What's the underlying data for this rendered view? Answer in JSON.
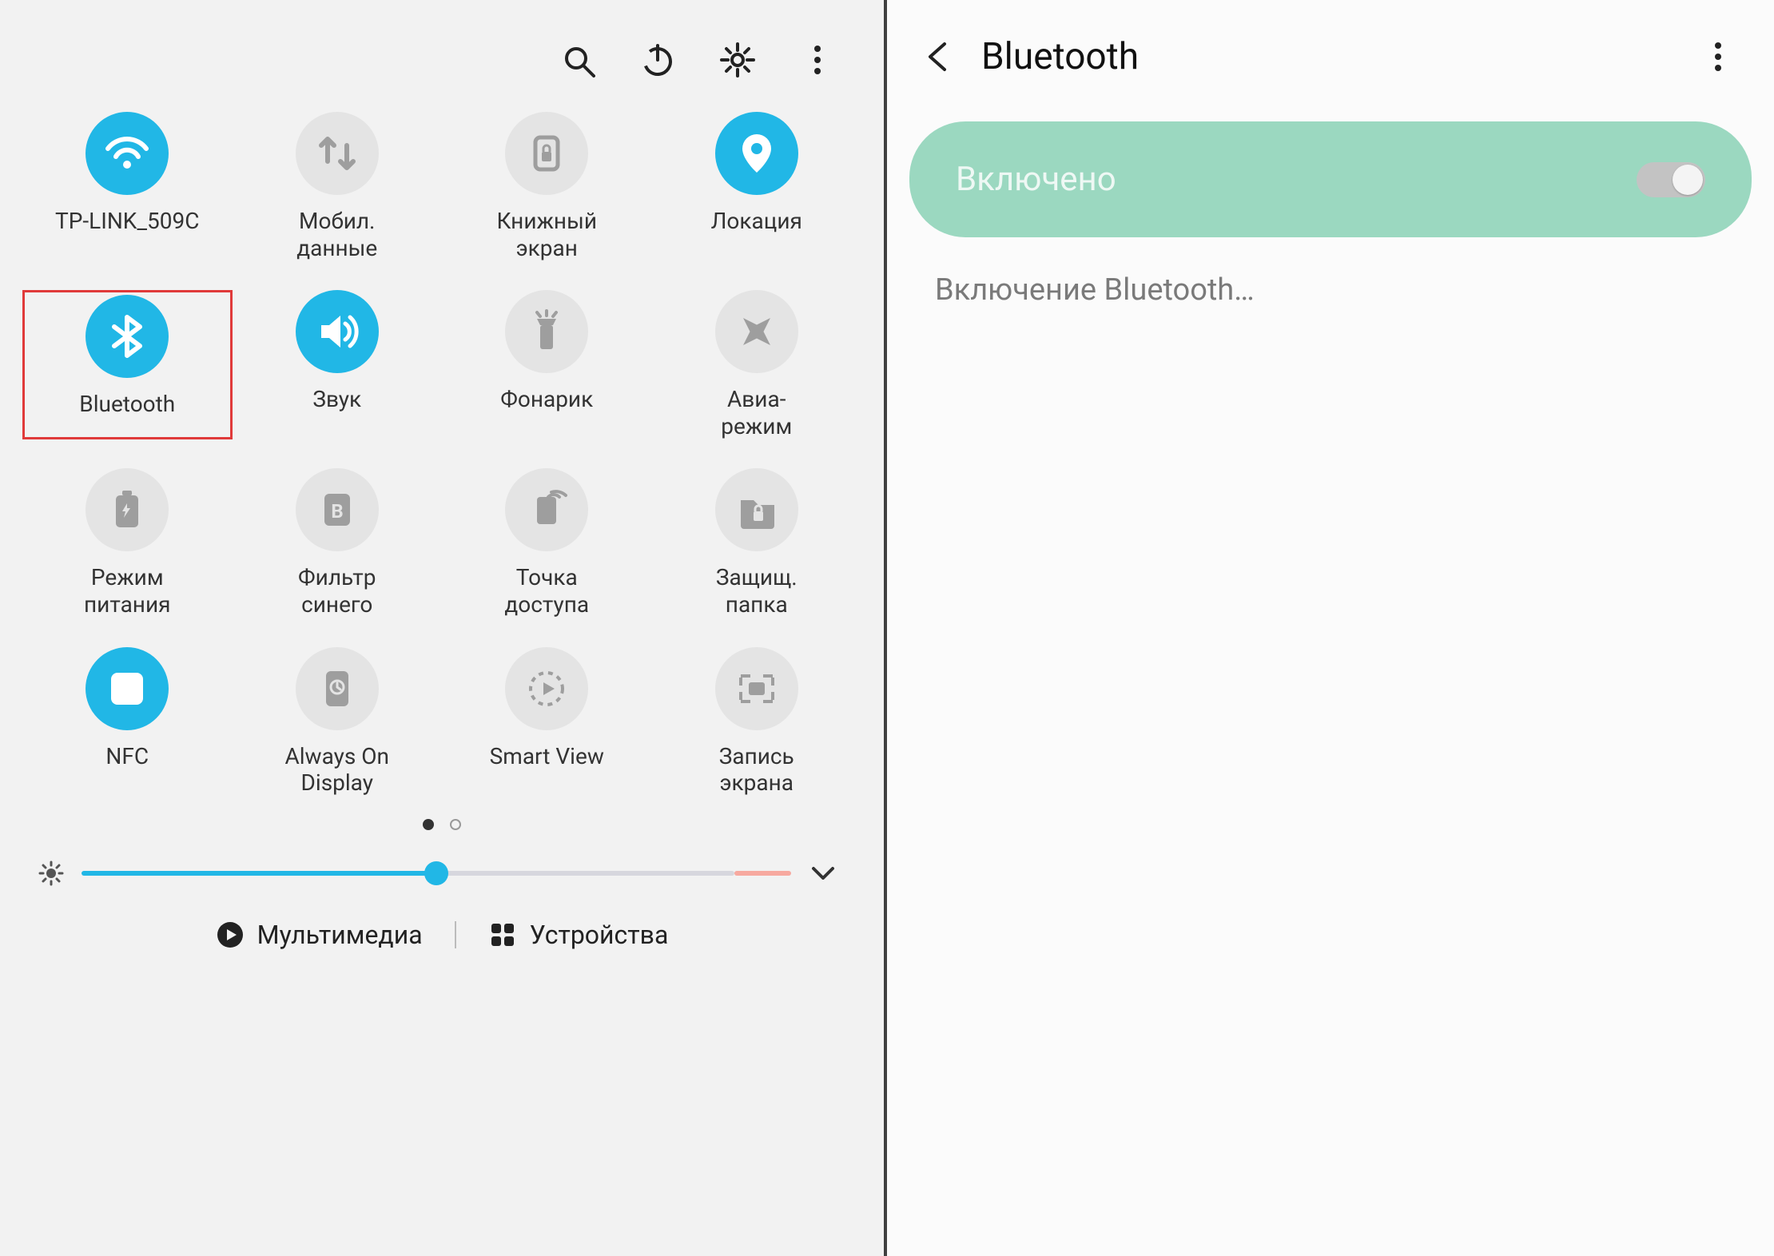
{
  "left": {
    "top_icons": [
      "search",
      "power",
      "settings",
      "more"
    ],
    "tiles": [
      {
        "id": "wifi",
        "label": "TP-LINK_509C",
        "active": true,
        "icon": "wifi"
      },
      {
        "id": "mobile-data",
        "label": "Мобил.\nданные",
        "active": false,
        "icon": "updown"
      },
      {
        "id": "book-screen",
        "label": "Книжный\nэкран",
        "active": false,
        "icon": "lock-portrait"
      },
      {
        "id": "location",
        "label": "Локация",
        "active": true,
        "icon": "location"
      },
      {
        "id": "bluetooth",
        "label": "Bluetooth",
        "active": true,
        "icon": "bluetooth",
        "highlighted": true
      },
      {
        "id": "sound",
        "label": "Звук",
        "active": true,
        "icon": "sound"
      },
      {
        "id": "flashlight",
        "label": "Фонарик",
        "active": false,
        "icon": "flashlight"
      },
      {
        "id": "airplane",
        "label": "Авиа-\nрежим",
        "active": false,
        "icon": "airplane"
      },
      {
        "id": "power-mode",
        "label": "Режим\nпитания",
        "active": false,
        "icon": "battery-recycle"
      },
      {
        "id": "blue-filter",
        "label": "Фильтр\nсинего",
        "active": false,
        "icon": "filter-b"
      },
      {
        "id": "hotspot",
        "label": "Точка\nдоступа",
        "active": false,
        "icon": "hotspot"
      },
      {
        "id": "secure-folder",
        "label": "Защищ.\nпапка",
        "active": false,
        "icon": "secure-folder"
      },
      {
        "id": "nfc",
        "label": "NFC",
        "active": true,
        "icon": "nfc"
      },
      {
        "id": "aod",
        "label": "Always On\nDisplay",
        "active": false,
        "icon": "aod"
      },
      {
        "id": "smartview",
        "label": "Smart View",
        "active": false,
        "icon": "smartview"
      },
      {
        "id": "screen-rec",
        "label": "Запись\nэкрана",
        "active": false,
        "icon": "screen-record"
      }
    ],
    "pages": {
      "current": 1,
      "total": 2
    },
    "brightness_percent": 50,
    "bottom": {
      "multimedia": "Мультимедиа",
      "devices": "Устройства"
    }
  },
  "right": {
    "title": "Bluetooth",
    "toggle_label": "Включено",
    "toggle_on": true,
    "status_text": "Включение Bluetooth…"
  },
  "colors": {
    "accent": "#21b7e6",
    "toggle_card": "#9bd8c0",
    "highlight": "#e03a3a"
  }
}
